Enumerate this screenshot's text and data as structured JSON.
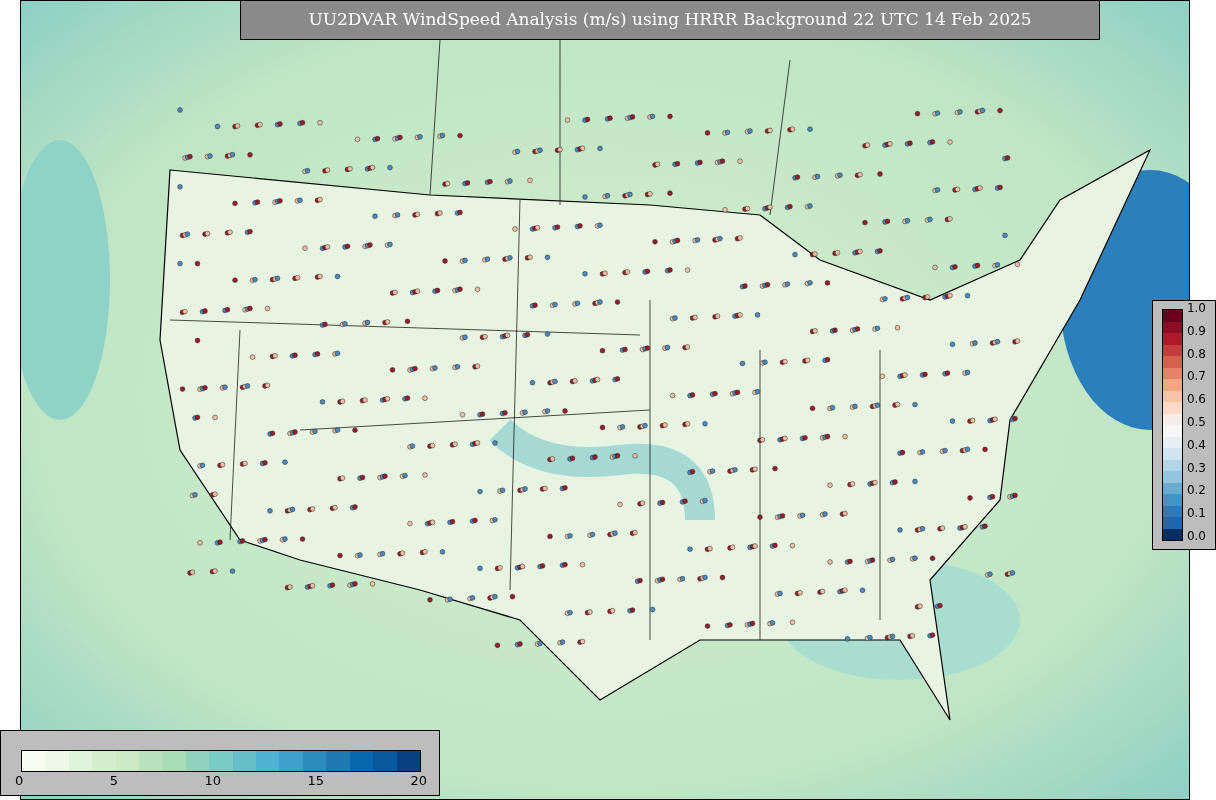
{
  "title": "UU2DVAR WindSpeed Analysis (m/s) using HRRR Background 22 UTC 14 Feb 2025",
  "right_colorbar": {
    "ticks": [
      "1.0",
      "0.9",
      "0.8",
      "0.7",
      "0.6",
      "0.5",
      "0.4",
      "0.3",
      "0.2",
      "0.1",
      "0.0"
    ]
  },
  "bottom_colorbar": {
    "ticks": [
      "0",
      "5",
      "10",
      "15",
      "20"
    ]
  }
}
